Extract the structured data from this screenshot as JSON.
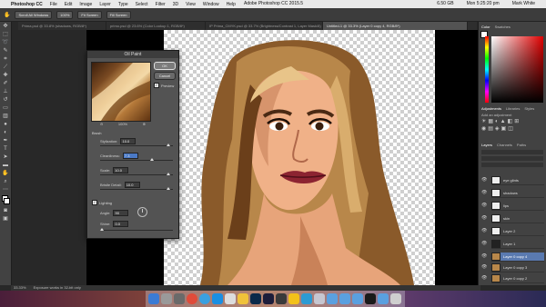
{
  "menubar": {
    "app_name": "Photoshop CC",
    "items": [
      "File",
      "Edit",
      "Image",
      "Layer",
      "Type",
      "Select",
      "Filter",
      "3D",
      "View",
      "Window",
      "Help"
    ],
    "window_title": "Adobe Photoshop CC 2015.5",
    "status": [
      "6.50 GB",
      "Mon 5:25:20 pm",
      "Mark White"
    ]
  },
  "options_bar": {
    "scroll_all": "Scroll All Windows",
    "zoom_value": "100%",
    "fit_screen": "Fit Screen",
    "fill_screen": "Fill Screen"
  },
  "tabs": [
    {
      "label": "Prima.psd @ 33.8% (shadows, RGB/8*)",
      "active": false
    },
    {
      "label": "primo.psd @ 23.6% (Color Lookup 1, RGB/8*)",
      "active": false
    },
    {
      "label": "IP Prima_CMYK.psd @ 33.7% (Brightness/Contrast 1, Layer Mask/8)",
      "active": false
    },
    {
      "label": "Untitled-1 @ 33.3% (Layer 0 copy 4, RGB/8*)",
      "active": true
    }
  ],
  "dialog": {
    "title": "Oil Paint",
    "ok": "OK",
    "cancel": "Cancel",
    "preview_label": "Preview",
    "preview_checked": true,
    "zoom": "100%",
    "brush_header": "Brush",
    "params": [
      {
        "label": "Stylization:",
        "value": "10.0",
        "level": 0.96
      },
      {
        "label": "Cleanliness:",
        "value": "7.3",
        "level": 0.72
      },
      {
        "label": "Scale:",
        "value": "10.0",
        "level": 0.96
      },
      {
        "label": "Bristle Detail:",
        "value": "10.0",
        "level": 0.96
      }
    ],
    "lighting_label": "Lighting",
    "lighting_checked": true,
    "angle_label": "Angle:",
    "angle_value": "90",
    "shine_label": "Shine:",
    "shine_value": "0.0",
    "shine_level": 0.0
  },
  "status_bar": {
    "zoom": "33.33%",
    "info": "Exposure works in 32-bit only"
  },
  "right_panel": {
    "color_tabs": [
      "Color",
      "Swatches"
    ],
    "adjust_tabs": [
      "Adjustments",
      "Libraries",
      "Styles"
    ],
    "adjust_hint": "Add an adjustment",
    "layer_tabs": [
      "Layers",
      "Channels",
      "Paths"
    ],
    "layers": [
      {
        "name": "eye glints",
        "selected": false
      },
      {
        "name": "shadows",
        "selected": false
      },
      {
        "name": "lips",
        "selected": false
      },
      {
        "name": "skin",
        "selected": false
      },
      {
        "name": "Layer 2",
        "selected": false
      },
      {
        "name": "Layer 1",
        "selected": false
      },
      {
        "name": "Layer 0 copy 4",
        "selected": true
      },
      {
        "name": "Layer 0 copy 3",
        "selected": false
      },
      {
        "name": "Layer 0 copy 2",
        "selected": false
      }
    ]
  }
}
